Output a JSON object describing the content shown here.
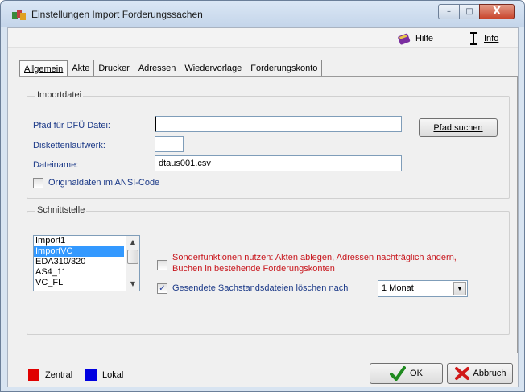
{
  "window": {
    "title": "Einstellungen Import Forderungssachen",
    "minimize": "–",
    "maximize": "□",
    "close": "X"
  },
  "helpbar": {
    "help_label": "Hilfe",
    "info_label": "Info"
  },
  "tabs": [
    {
      "label": "Allgemein"
    },
    {
      "label": "Akte"
    },
    {
      "label": "Drucker"
    },
    {
      "label": "Adressen"
    },
    {
      "label": "Wiedervorlage"
    },
    {
      "label": "Forderungskonto"
    }
  ],
  "importdatei": {
    "group_title": "Importdatei",
    "path_label": "Pfad für DFÜ Datei:",
    "path_value": "",
    "browse_button": "Pfad suchen",
    "drive_label": "Diskettenlaufwerk:",
    "drive_value": "",
    "filename_label": "Dateiname:",
    "filename_value": "dtaus001.csv",
    "ansi_label": "Originaldaten im ANSI-Code",
    "ansi_checked": false
  },
  "schnittstelle": {
    "group_title": "Schnittstelle",
    "items": [
      "Import1",
      "ImportVC",
      "EDA310/320",
      "AS4_11",
      "VC_FL"
    ],
    "selected_index": 1,
    "sonder_label_line1": "Sonderfunktionen nutzen: Akten ablegen, Adressen nachträglich ändern,",
    "sonder_label_line2": "Buchen in bestehende Forderungskonten",
    "sonder_checked": false,
    "delete_label": "Gesendete Sachstandsdateien löschen nach",
    "delete_checked": true,
    "delete_select_value": "1 Monat"
  },
  "footer": {
    "zentral_label": "Zentral",
    "lokal_label": "Lokal",
    "zentral_color": "#e00000",
    "lokal_color": "#0000e0",
    "ok_label": "OK",
    "cancel_label": "Abbruch"
  },
  "colors": {
    "label_blue": "#1c3a88",
    "warning_red": "#c8161d",
    "selection_blue": "#3399ff"
  }
}
